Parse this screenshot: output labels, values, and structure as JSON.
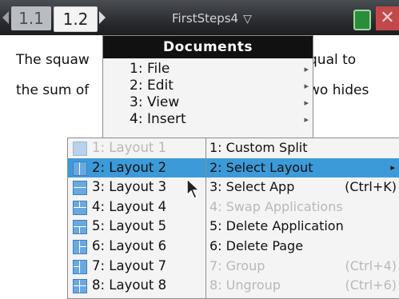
{
  "topbar": {
    "tabs": [
      {
        "label": "1.1"
      },
      {
        "label": "1.2"
      }
    ],
    "document_title": "FirstSteps4",
    "title_chevron": "▽"
  },
  "background_text": {
    "line1_left": "The squaw",
    "line1_right": "qual to",
    "line2_left": "the sum of",
    "line2_right": "wo hides"
  },
  "documents_menu": {
    "title": "Documents",
    "items": [
      {
        "label": "1: File",
        "arrow": "▸"
      },
      {
        "label": "2: Edit",
        "arrow": "▸"
      },
      {
        "label": "3: View",
        "arrow": "▸"
      },
      {
        "label": "4: Insert",
        "arrow": "▸"
      }
    ]
  },
  "tools_menu": {
    "items": [
      {
        "label": "1: Custom Split",
        "shortcut": ""
      },
      {
        "label": "2: Select Layout",
        "shortcut": "",
        "arrow": "▸"
      },
      {
        "label": "3: Select App",
        "shortcut": "(Ctrl+K)"
      },
      {
        "label": "4: Swap Applications",
        "shortcut": ""
      },
      {
        "label": "5: Delete Application",
        "shortcut": ""
      },
      {
        "label": "6: Delete Page",
        "shortcut": ""
      },
      {
        "label": "7: Group",
        "shortcut": "(Ctrl+4)"
      },
      {
        "label": "8: Ungroup",
        "shortcut": "(Ctrl+6)"
      }
    ]
  },
  "layout_menu": {
    "items": [
      {
        "label": "1: Layout 1"
      },
      {
        "label": "2: Layout 2"
      },
      {
        "label": "3: Layout 3"
      },
      {
        "label": "4: Layout 4"
      },
      {
        "label": "5: Layout 5"
      },
      {
        "label": "6: Layout 6"
      },
      {
        "label": "7: Layout 7"
      },
      {
        "label": "8: Layout 8"
      }
    ]
  },
  "colors": {
    "selection": "#3d9ad8",
    "menu_header": "#111111",
    "disabled_text": "#b8b8b8",
    "close_button": "#c2484a",
    "battery": "#2a8d3a"
  }
}
